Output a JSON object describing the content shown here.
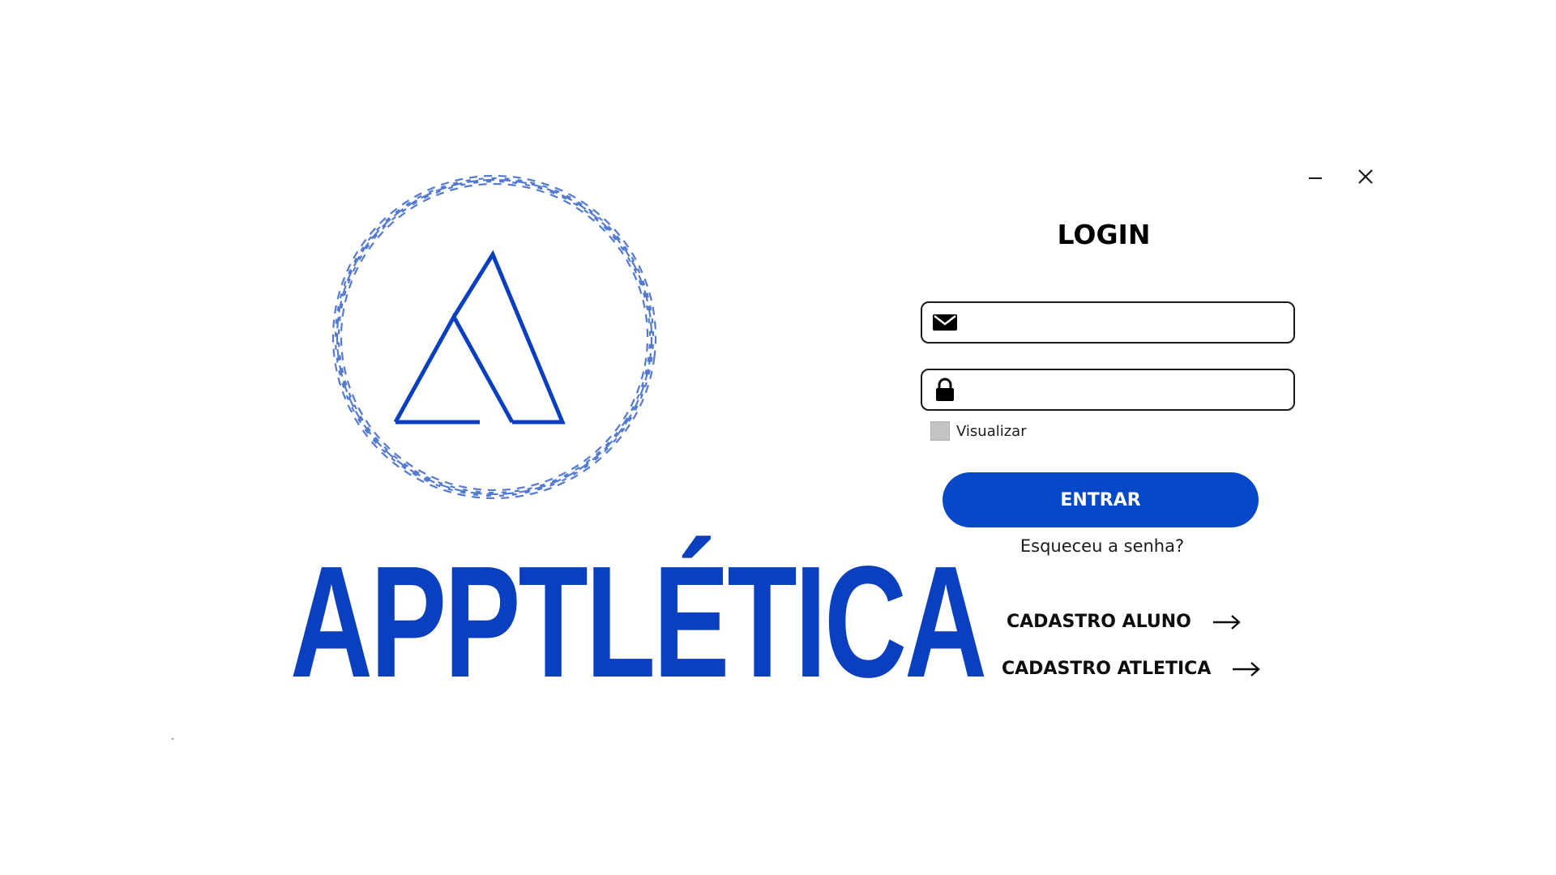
{
  "colors": {
    "brand_blue": "#0a3fbf",
    "emblem_blue": "#4a72cf",
    "button_blue": "#0748c8",
    "text_dark": "#0d0d0d"
  },
  "brand": {
    "wordmark": "APPTLÉTICA",
    "emblem_icon": "circular-rope-triangle-emblem"
  },
  "window": {
    "minimize_icon": "minimize-icon",
    "close_icon": "close-icon"
  },
  "login": {
    "title": "LOGIN",
    "email": {
      "icon": "envelope-icon",
      "value": "",
      "placeholder": ""
    },
    "password": {
      "icon": "lock-icon",
      "value": "",
      "placeholder": ""
    },
    "show_password": {
      "label": "Visualizar",
      "checked": false
    },
    "submit_label": "ENTRAR",
    "forgot_label": "Esqueceu a senha?"
  },
  "signup": {
    "aluno_label": "CADASTRO ALUNO",
    "atletica_label": "CADASTRO ATLETICA",
    "arrow_icon": "arrow-right-icon"
  }
}
